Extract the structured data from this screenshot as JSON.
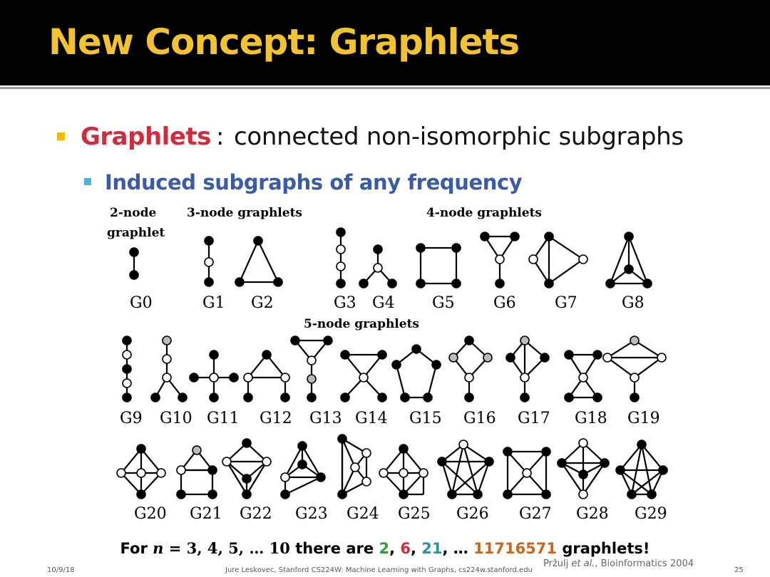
{
  "slide": {
    "title": "New Concept: Graphlets",
    "bullet1": {
      "key": "Graphlets",
      "colon": ":",
      "text": "connected non-isomorphic subgraphs"
    },
    "bullet2": {
      "text": "Induced subgraphs of any frequency"
    },
    "bottom": {
      "prefix": "For ",
      "n_label": "n",
      "eq": " = 3, 4, 5, … 10",
      "mid": " there are ",
      "v1": "2",
      "sep1": ", ",
      "v2": "6",
      "sep2": ", ",
      "v3": "21",
      "sep3": ", … ",
      "v4": "11716571",
      "suffix": " graphlets!"
    },
    "citation_author": "Pržulj ",
    "citation_etal": "et al.",
    "citation_rest": ", Bioinformatics 2004",
    "footer": {
      "date": "10/9/18",
      "center": "Jure Leskovec, Stanford CS224W: Machine Learning with Graphs, cs224w.stanford.edu",
      "page": "25"
    }
  },
  "figure": {
    "section_2node": "2-node",
    "section_2node_b": "graphlet",
    "section_3node": "3-node graphlets",
    "section_4node": "4-node graphlets",
    "section_5node": "5-node graphlets",
    "labels": [
      "G0",
      "G1",
      "G2",
      "G3",
      "G4",
      "G5",
      "G6",
      "G7",
      "G8",
      "G9",
      "G10",
      "G11",
      "G12",
      "G13",
      "G14",
      "G15",
      "G16",
      "G17",
      "G18",
      "G19",
      "G20",
      "G21",
      "G22",
      "G23",
      "G24",
      "G25",
      "G26",
      "G27",
      "G28",
      "G29"
    ]
  },
  "colors": {
    "title_bar": "#000000",
    "title_text": "#f2c230",
    "graphlets_red": "#d22b3c",
    "body_text": "#111111",
    "bullet_gold": "#f5b800",
    "subbullet_teal": "#4bb4d6",
    "subbullet_blue": "#3b5ba8",
    "green": "#3a9a3a",
    "red": "#d22b3c",
    "teal": "#2e8fa0",
    "orange": "#c7681e"
  }
}
